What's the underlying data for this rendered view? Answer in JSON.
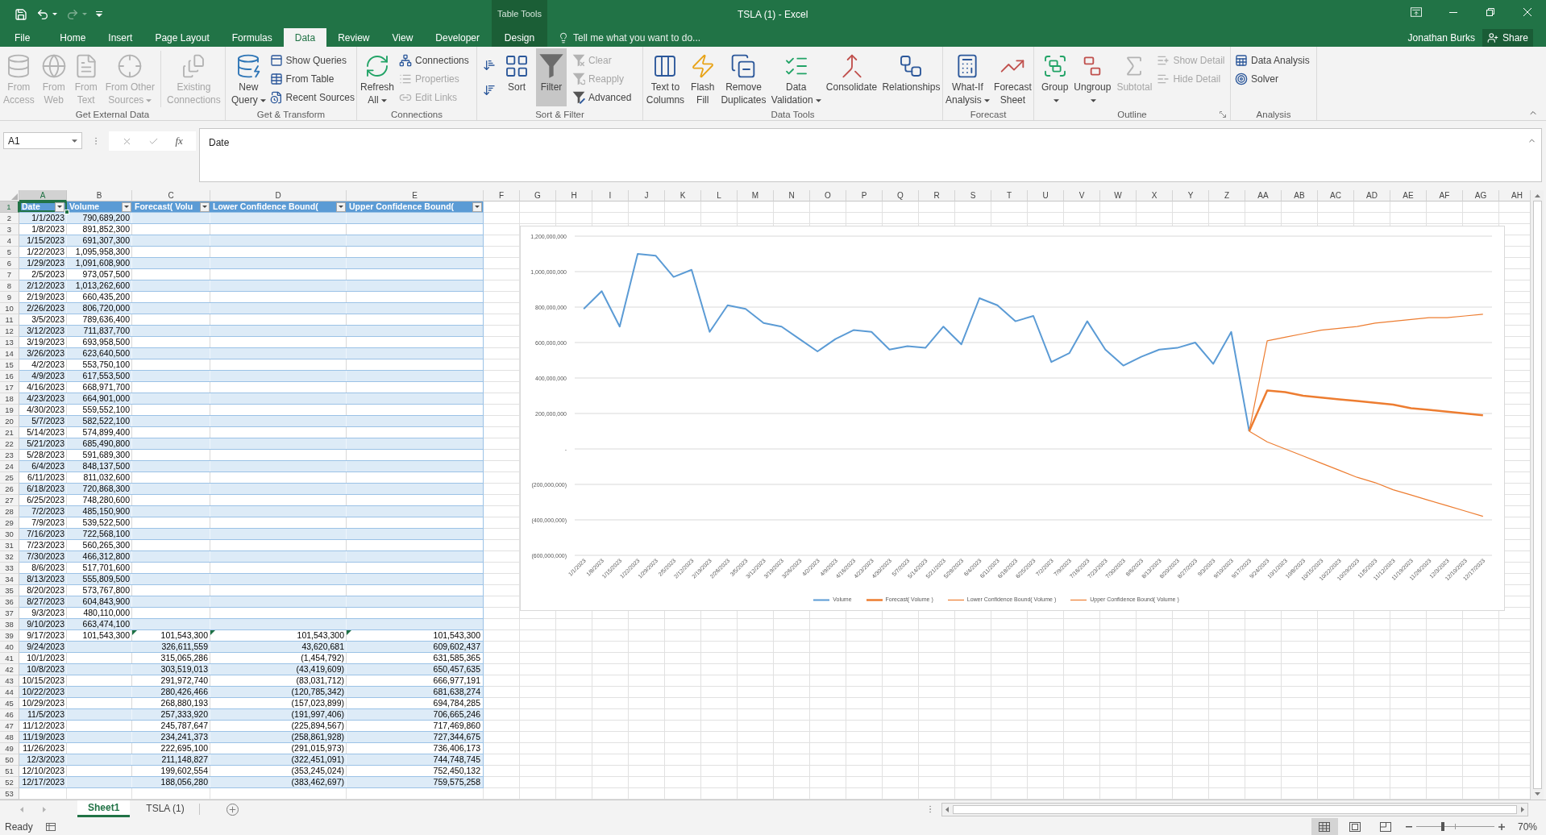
{
  "title_bar": {
    "title": "TSLA (1) - Excel",
    "context_label": "Table Tools"
  },
  "quick_access": [
    {
      "disabled": false,
      "dropdown": false
    },
    {
      "disabled": false,
      "dropdown": true
    },
    {
      "disabled": true,
      "dropdown": true
    }
  ],
  "ribbon_tabs": [
    {
      "label": "File",
      "selected": false,
      "contextual": false
    },
    {
      "label": "Home",
      "selected": false,
      "contextual": false
    },
    {
      "label": "Insert",
      "selected": false,
      "contextual": false
    },
    {
      "label": "Page Layout",
      "selected": false,
      "contextual": false
    },
    {
      "label": "Formulas",
      "selected": false,
      "contextual": false
    },
    {
      "label": "Data",
      "selected": true,
      "contextual": false
    },
    {
      "label": "Review",
      "selected": false,
      "contextual": false
    },
    {
      "label": "View",
      "selected": false,
      "contextual": false
    },
    {
      "label": "Developer",
      "selected": false,
      "contextual": false
    },
    {
      "label": "Design",
      "selected": false,
      "contextual": true
    }
  ],
  "tell_me": {
    "placeholder": "Tell me what you want to do..."
  },
  "account": {
    "user_name": "Jonathan Burks",
    "share_button": "Share"
  },
  "ribbon_groups": [
    {
      "label": "Get External Data",
      "launcher": false,
      "commands": [
        {
          "label": "From Access",
          "kind": "large",
          "disabled": true,
          "dropdown": false,
          "pressed": false
        },
        {
          "label": "From Web",
          "kind": "large",
          "disabled": true,
          "dropdown": false,
          "pressed": false
        },
        {
          "label": "From Text",
          "kind": "large",
          "disabled": true,
          "dropdown": false,
          "pressed": false
        },
        {
          "label": "From Other Sources",
          "kind": "large",
          "disabled": true,
          "dropdown": true,
          "pressed": false
        },
        {
          "kind": "separator"
        },
        {
          "label": "Existing Connections",
          "kind": "large",
          "disabled": true,
          "dropdown": false,
          "pressed": false
        }
      ]
    },
    {
      "label": "Get & Transform",
      "launcher": false,
      "commands": [
        {
          "label": "New Query",
          "kind": "large",
          "disabled": false,
          "dropdown": true,
          "pressed": false
        },
        {
          "label": "Show Queries",
          "kind": "small",
          "disabled": false,
          "dropdown": false,
          "pressed": false
        },
        {
          "label": "From Table",
          "kind": "small",
          "disabled": false,
          "dropdown": false,
          "pressed": false
        },
        {
          "label": "Recent Sources",
          "kind": "small",
          "disabled": false,
          "dropdown": false,
          "pressed": false
        }
      ]
    },
    {
      "label": "Connections",
      "launcher": false,
      "commands": [
        {
          "label": "Refresh All",
          "kind": "large",
          "disabled": false,
          "dropdown": true,
          "pressed": false
        },
        {
          "label": "Connections",
          "kind": "small",
          "disabled": false,
          "dropdown": false,
          "pressed": false
        },
        {
          "label": "Properties",
          "kind": "small",
          "disabled": true,
          "dropdown": false,
          "pressed": false
        },
        {
          "label": "Edit Links",
          "kind": "small",
          "disabled": true,
          "dropdown": false,
          "pressed": false
        }
      ]
    },
    {
      "label": "Sort & Filter",
      "launcher": false,
      "commands": [
        {
          "kind": "icon",
          "disabled": false,
          "dropdown": false,
          "pressed": false
        },
        {
          "kind": "icon",
          "disabled": false,
          "dropdown": false,
          "pressed": false
        },
        {
          "label": "Sort",
          "kind": "large",
          "disabled": false,
          "dropdown": false,
          "pressed": false
        },
        {
          "label": "Filter",
          "kind": "large",
          "disabled": false,
          "dropdown": false,
          "pressed": true
        },
        {
          "label": "Clear",
          "kind": "small",
          "disabled": true,
          "dropdown": false,
          "pressed": false
        },
        {
          "label": "Reapply",
          "kind": "small",
          "disabled": true,
          "dropdown": false,
          "pressed": false
        },
        {
          "label": "Advanced",
          "kind": "small",
          "disabled": false,
          "dropdown": false,
          "pressed": false
        }
      ]
    },
    {
      "label": "Data Tools",
      "launcher": false,
      "commands": [
        {
          "label": "Text to Columns",
          "kind": "large",
          "disabled": false,
          "dropdown": false,
          "pressed": false
        },
        {
          "label": "Flash Fill",
          "kind": "large",
          "disabled": false,
          "dropdown": false,
          "pressed": false
        },
        {
          "label": "Remove Duplicates",
          "kind": "large",
          "disabled": false,
          "dropdown": false,
          "pressed": false
        },
        {
          "label": "Data Validation",
          "kind": "large",
          "disabled": false,
          "dropdown": true,
          "pressed": false
        },
        {
          "label": "Consolidate",
          "kind": "large",
          "disabled": false,
          "dropdown": false,
          "pressed": false
        },
        {
          "label": "Relationships",
          "kind": "large",
          "disabled": false,
          "dropdown": false,
          "pressed": false
        }
      ]
    },
    {
      "label": "Forecast",
      "launcher": false,
      "commands": [
        {
          "label": "What-If Analysis",
          "kind": "large",
          "disabled": false,
          "dropdown": true,
          "pressed": false
        },
        {
          "label": "Forecast Sheet",
          "kind": "large",
          "disabled": false,
          "dropdown": false,
          "pressed": false
        }
      ]
    },
    {
      "label": "Outline",
      "launcher": true,
      "commands": [
        {
          "label": "Group",
          "kind": "large",
          "disabled": false,
          "dropdown": true,
          "pressed": false
        },
        {
          "label": "Ungroup",
          "kind": "large",
          "disabled": false,
          "dropdown": true,
          "pressed": false
        },
        {
          "label": "Subtotal",
          "kind": "large",
          "disabled": true,
          "dropdown": false,
          "pressed": false
        },
        {
          "label": "Show Detail",
          "kind": "small",
          "disabled": true,
          "dropdown": false,
          "pressed": false
        },
        {
          "label": "Hide Detail",
          "kind": "small",
          "disabled": true,
          "dropdown": false,
          "pressed": false
        }
      ]
    },
    {
      "label": "Analysis",
      "launcher": false,
      "commands": [
        {
          "label": "Data Analysis",
          "kind": "small",
          "disabled": false,
          "dropdown": false,
          "pressed": false
        },
        {
          "label": "Solver",
          "kind": "small",
          "disabled": false,
          "dropdown": false,
          "pressed": false
        }
      ]
    }
  ],
  "formula_bar": {
    "name_box": "A1",
    "function_button": "fx",
    "formula": "Date"
  },
  "sheet": {
    "column_headers": [
      {
        "label": "A",
        "selected": true
      },
      {
        "label": "B",
        "selected": false
      },
      {
        "label": "C",
        "selected": false
      },
      {
        "label": "D",
        "selected": false
      },
      {
        "label": "E",
        "selected": false
      },
      {
        "label": "F",
        "selected": false
      },
      {
        "label": "G",
        "selected": false
      },
      {
        "label": "H",
        "selected": false
      },
      {
        "label": "I",
        "selected": false
      },
      {
        "label": "J",
        "selected": false
      },
      {
        "label": "K",
        "selected": false
      },
      {
        "label": "L",
        "selected": false
      },
      {
        "label": "M",
        "selected": false
      },
      {
        "label": "N",
        "selected": false
      },
      {
        "label": "O",
        "selected": false
      },
      {
        "label": "P",
        "selected": false
      },
      {
        "label": "Q",
        "selected": false
      },
      {
        "label": "R",
        "selected": false
      },
      {
        "label": "S",
        "selected": false
      },
      {
        "label": "T",
        "selected": false
      },
      {
        "label": "U",
        "selected": false
      },
      {
        "label": "V",
        "selected": false
      },
      {
        "label": "W",
        "selected": false
      },
      {
        "label": "X",
        "selected": false
      },
      {
        "label": "Y",
        "selected": false
      },
      {
        "label": "Z",
        "selected": false
      },
      {
        "label": "AA",
        "selected": false
      },
      {
        "label": "AB",
        "selected": false
      },
      {
        "label": "AC",
        "selected": false
      },
      {
        "label": "AD",
        "selected": false
      },
      {
        "label": "AE",
        "selected": false
      },
      {
        "label": "AF",
        "selected": false
      },
      {
        "label": "AG",
        "selected": false
      },
      {
        "label": "AH",
        "selected": false
      }
    ],
    "row_headers": [
      {
        "label": "1",
        "selected": true
      },
      {
        "label": "2",
        "selected": false
      },
      {
        "label": "3",
        "selected": false
      },
      {
        "label": "4",
        "selected": false
      },
      {
        "label": "5",
        "selected": false
      },
      {
        "label": "6",
        "selected": false
      },
      {
        "label": "7",
        "selected": false
      },
      {
        "label": "8",
        "selected": false
      },
      {
        "label": "9",
        "selected": false
      },
      {
        "label": "10",
        "selected": false
      },
      {
        "label": "11",
        "selected": false
      },
      {
        "label": "12",
        "selected": false
      },
      {
        "label": "13",
        "selected": false
      },
      {
        "label": "14",
        "selected": false
      },
      {
        "label": "15",
        "selected": false
      },
      {
        "label": "16",
        "selected": false
      },
      {
        "label": "17",
        "selected": false
      },
      {
        "label": "18",
        "selected": false
      },
      {
        "label": "19",
        "selected": false
      },
      {
        "label": "20",
        "selected": false
      },
      {
        "label": "21",
        "selected": false
      },
      {
        "label": "22",
        "selected": false
      },
      {
        "label": "23",
        "selected": false
      },
      {
        "label": "24",
        "selected": false
      },
      {
        "label": "25",
        "selected": false
      },
      {
        "label": "26",
        "selected": false
      },
      {
        "label": "27",
        "selected": false
      },
      {
        "label": "28",
        "selected": false
      },
      {
        "label": "29",
        "selected": false
      },
      {
        "label": "30",
        "selected": false
      },
      {
        "label": "31",
        "selected": false
      },
      {
        "label": "32",
        "selected": false
      },
      {
        "label": "33",
        "selected": false
      },
      {
        "label": "34",
        "selected": false
      },
      {
        "label": "35",
        "selected": false
      },
      {
        "label": "36",
        "selected": false
      },
      {
        "label": "37",
        "selected": false
      },
      {
        "label": "38",
        "selected": false
      },
      {
        "label": "39",
        "selected": false
      },
      {
        "label": "40",
        "selected": false
      },
      {
        "label": "41",
        "selected": false
      },
      {
        "label": "42",
        "selected": false
      },
      {
        "label": "43",
        "selected": false
      },
      {
        "label": "44",
        "selected": false
      },
      {
        "label": "45",
        "selected": false
      },
      {
        "label": "46",
        "selected": false
      },
      {
        "label": "47",
        "selected": false
      },
      {
        "label": "48",
        "selected": false
      },
      {
        "label": "49",
        "selected": false
      },
      {
        "label": "50",
        "selected": false
      },
      {
        "label": "51",
        "selected": false
      },
      {
        "label": "52",
        "selected": false
      },
      {
        "label": "53",
        "selected": false
      }
    ],
    "table": {
      "columns": [
        {
          "label": "Date"
        },
        {
          "label": "Volume"
        },
        {
          "label": "Forecast( Volu"
        },
        {
          "label": "Lower Confidence Bound("
        },
        {
          "label": "Upper Confidence Bound("
        }
      ],
      "rows": [
        {
          "date": "1/1/2023",
          "volume": "790,689,200",
          "flagged": false
        },
        {
          "date": "1/8/2023",
          "volume": "891,852,300",
          "flagged": false
        },
        {
          "date": "1/15/2023",
          "volume": "691,307,300",
          "flagged": false
        },
        {
          "date": "1/22/2023",
          "volume": "1,095,958,300",
          "flagged": false
        },
        {
          "date": "1/29/2023",
          "volume": "1,091,608,900",
          "flagged": false
        },
        {
          "date": "2/5/2023",
          "volume": "973,057,500",
          "flagged": false
        },
        {
          "date": "2/12/2023",
          "volume": "1,013,262,600",
          "flagged": false
        },
        {
          "date": "2/19/2023",
          "volume": "660,435,200",
          "flagged": false
        },
        {
          "date": "2/26/2023",
          "volume": "806,720,000",
          "flagged": false
        },
        {
          "date": "3/5/2023",
          "volume": "789,636,400",
          "flagged": false
        },
        {
          "date": "3/12/2023",
          "volume": "711,837,700",
          "flagged": false
        },
        {
          "date": "3/19/2023",
          "volume": "693,958,500",
          "flagged": false
        },
        {
          "date": "3/26/2023",
          "volume": "623,640,500",
          "flagged": false
        },
        {
          "date": "4/2/2023",
          "volume": "553,750,100",
          "flagged": false
        },
        {
          "date": "4/9/2023",
          "volume": "617,553,500",
          "flagged": false
        },
        {
          "date": "4/16/2023",
          "volume": "668,971,700",
          "flagged": false
        },
        {
          "date": "4/23/2023",
          "volume": "664,901,000",
          "flagged": false
        },
        {
          "date": "4/30/2023",
          "volume": "559,552,100",
          "flagged": false
        },
        {
          "date": "5/7/2023",
          "volume": "582,522,100",
          "flagged": false
        },
        {
          "date": "5/14/2023",
          "volume": "574,899,400",
          "flagged": false
        },
        {
          "date": "5/21/2023",
          "volume": "685,490,800",
          "flagged": false
        },
        {
          "date": "5/28/2023",
          "volume": "591,689,300",
          "flagged": false
        },
        {
          "date": "6/4/2023",
          "volume": "848,137,500",
          "flagged": false
        },
        {
          "date": "6/11/2023",
          "volume": "811,032,600",
          "flagged": false
        },
        {
          "date": "6/18/2023",
          "volume": "720,868,300",
          "flagged": false
        },
        {
          "date": "6/25/2023",
          "volume": "748,280,600",
          "flagged": false
        },
        {
          "date": "7/2/2023",
          "volume": "485,150,900",
          "flagged": false
        },
        {
          "date": "7/9/2023",
          "volume": "539,522,500",
          "flagged": false
        },
        {
          "date": "7/16/2023",
          "volume": "722,568,100",
          "flagged": false
        },
        {
          "date": "7/23/2023",
          "volume": "560,265,300",
          "flagged": false
        },
        {
          "date": "7/30/2023",
          "volume": "466,312,800",
          "flagged": false
        },
        {
          "date": "8/6/2023",
          "volume": "517,701,600",
          "flagged": false
        },
        {
          "date": "8/13/2023",
          "volume": "555,809,500",
          "flagged": false
        },
        {
          "date": "8/20/2023",
          "volume": "573,767,800",
          "flagged": false
        },
        {
          "date": "8/27/2023",
          "volume": "604,843,900",
          "flagged": false
        },
        {
          "date": "9/3/2023",
          "volume": "480,110,000",
          "flagged": false
        },
        {
          "date": "9/10/2023",
          "volume": "663,474,100",
          "flagged": false
        },
        {
          "date": "9/17/2023",
          "volume": "101,543,300",
          "forecast": "101,543,300",
          "lower_bound": "101,543,300",
          "upper_bound": "101,543,300",
          "flagged": true
        },
        {
          "date": "9/24/2023",
          "forecast": "326,611,559",
          "lower_bound": "43,620,681",
          "upper_bound": "609,602,437",
          "flagged": false
        },
        {
          "date": "10/1/2023",
          "forecast": "315,065,286",
          "lower_bound": "(1,454,792)",
          "upper_bound": "631,585,365",
          "flagged": false
        },
        {
          "date": "10/8/2023",
          "forecast": "303,519,013",
          "lower_bound": "(43,419,609)",
          "upper_bound": "650,457,635",
          "flagged": false
        },
        {
          "date": "10/15/2023",
          "forecast": "291,972,740",
          "lower_bound": "(83,031,712)",
          "upper_bound": "666,977,191",
          "flagged": false
        },
        {
          "date": "10/22/2023",
          "forecast": "280,426,466",
          "lower_bound": "(120,785,342)",
          "upper_bound": "681,638,274",
          "flagged": false
        },
        {
          "date": "10/29/2023",
          "forecast": "268,880,193",
          "lower_bound": "(157,023,899)",
          "upper_bound": "694,784,285",
          "flagged": false
        },
        {
          "date": "11/5/2023",
          "forecast": "257,333,920",
          "lower_bound": "(191,997,406)",
          "upper_bound": "706,665,246",
          "flagged": false
        },
        {
          "date": "11/12/2023",
          "forecast": "245,787,647",
          "lower_bound": "(225,894,567)",
          "upper_bound": "717,469,860",
          "flagged": false
        },
        {
          "date": "11/19/2023",
          "forecast": "234,241,373",
          "lower_bound": "(258,861,928)",
          "upper_bound": "727,344,675",
          "flagged": false
        },
        {
          "date": "11/26/2023",
          "forecast": "222,695,100",
          "lower_bound": "(291,015,973)",
          "upper_bound": "736,406,173",
          "flagged": false
        },
        {
          "date": "12/3/2023",
          "forecast": "211,148,827",
          "lower_bound": "(322,451,091)",
          "upper_bound": "744,748,745",
          "flagged": false
        },
        {
          "date": "12/10/2023",
          "forecast": "199,602,554",
          "lower_bound": "(353,245,024)",
          "upper_bound": "752,450,132",
          "flagged": false
        },
        {
          "date": "12/17/2023",
          "forecast": "188,056,280",
          "lower_bound": "(383,462,697)",
          "upper_bound": "759,575,258",
          "flagged": false
        }
      ]
    }
  },
  "chart": {
    "chart_data": {
      "type": "line",
      "categories": [
        "1/1/2023",
        "1/8/2023",
        "1/15/2023",
        "1/22/2023",
        "1/29/2023",
        "2/5/2023",
        "2/12/2023",
        "2/19/2023",
        "2/26/2023",
        "3/5/2023",
        "3/12/2023",
        "3/19/2023",
        "3/26/2023",
        "4/2/2023",
        "4/9/2023",
        "4/16/2023",
        "4/23/2023",
        "4/30/2023",
        "5/7/2023",
        "5/14/2023",
        "5/21/2023",
        "5/28/2023",
        "6/4/2023",
        "6/11/2023",
        "6/18/2023",
        "6/25/2023",
        "7/2/2023",
        "7/9/2023",
        "7/16/2023",
        "7/23/2023",
        "7/30/2023",
        "8/6/2023",
        "8/13/2023",
        "8/20/2023",
        "8/27/2023",
        "9/3/2023",
        "9/10/2023",
        "9/17/2023",
        "9/24/2023",
        "10/1/2023",
        "10/8/2023",
        "10/15/2023",
        "10/22/2023",
        "10/29/2023",
        "11/5/2023",
        "11/12/2023",
        "11/19/2023",
        "11/26/2023",
        "12/3/2023",
        "12/10/2023",
        "12/17/2023"
      ],
      "series": [
        {
          "name": "Volume",
          "color": "#5b9bd5",
          "values": [
            790000000,
            890000000,
            690000000,
            1100000000,
            1090000000,
            970000000,
            1010000000,
            660000000,
            810000000,
            790000000,
            710000000,
            690000000,
            620000000,
            550000000,
            620000000,
            670000000,
            660000000,
            560000000,
            580000000,
            570000000,
            690000000,
            590000000,
            850000000,
            810000000,
            720000000,
            750000000,
            490000000,
            540000000,
            720000000,
            560000000,
            470000000,
            520000000,
            560000000,
            570000000,
            600000000,
            480000000,
            660000000,
            100000000,
            null,
            null,
            null,
            null,
            null,
            null,
            null,
            null,
            null,
            null,
            null,
            null,
            null
          ]
        },
        {
          "name": "Forecast( Volume )",
          "color": "#ed7d31",
          "values": [
            null,
            null,
            null,
            null,
            null,
            null,
            null,
            null,
            null,
            null,
            null,
            null,
            null,
            null,
            null,
            null,
            null,
            null,
            null,
            null,
            null,
            null,
            null,
            null,
            null,
            null,
            null,
            null,
            null,
            null,
            null,
            null,
            null,
            null,
            null,
            null,
            null,
            100000000,
            330000000,
            320000000,
            300000000,
            290000000,
            280000000,
            270000000,
            260000000,
            250000000,
            230000000,
            220000000,
            210000000,
            200000000,
            190000000
          ]
        },
        {
          "name": "Lower Confidence Bound( Volume )",
          "color": "#ed7d31",
          "values": [
            null,
            null,
            null,
            null,
            null,
            null,
            null,
            null,
            null,
            null,
            null,
            null,
            null,
            null,
            null,
            null,
            null,
            null,
            null,
            null,
            null,
            null,
            null,
            null,
            null,
            null,
            null,
            null,
            null,
            null,
            null,
            null,
            null,
            null,
            null,
            null,
            null,
            100000000,
            40000000,
            0,
            -40000000,
            -80000000,
            -120000000,
            -160000000,
            -190000000,
            -230000000,
            -260000000,
            -290000000,
            -320000000,
            -350000000,
            -380000000
          ]
        },
        {
          "name": "Upper Confidence Bound( Volume )",
          "color": "#ed7d31",
          "values": [
            null,
            null,
            null,
            null,
            null,
            null,
            null,
            null,
            null,
            null,
            null,
            null,
            null,
            null,
            null,
            null,
            null,
            null,
            null,
            null,
            null,
            null,
            null,
            null,
            null,
            null,
            null,
            null,
            null,
            null,
            null,
            null,
            null,
            null,
            null,
            null,
            null,
            100000000,
            610000000,
            630000000,
            650000000,
            670000000,
            680000000,
            690000000,
            710000000,
            720000000,
            730000000,
            740000000,
            740000000,
            750000000,
            760000000
          ]
        }
      ],
      "ylim": [
        -600000000,
        1200000000
      ],
      "yticks": [
        {
          "value": 1200000000,
          "label": "1,200,000,000"
        },
        {
          "value": 1000000000,
          "label": "1,000,000,000"
        },
        {
          "value": 800000000,
          "label": "800,000,000"
        },
        {
          "value": 600000000,
          "label": "600,000,000"
        },
        {
          "value": 400000000,
          "label": "400,000,000"
        },
        {
          "value": 200000000,
          "label": "200,000,000"
        },
        {
          "value": 0,
          "label": "-"
        },
        {
          "value": -200000000,
          "label": "(200,000,000)"
        },
        {
          "value": -400000000,
          "label": "(400,000,000)"
        },
        {
          "value": -600000000,
          "label": "(600,000,000)"
        }
      ],
      "grid": true,
      "legend": "bottom"
    }
  },
  "sheet_tabs": [
    {
      "label": "Sheet1",
      "selected": true
    },
    {
      "label": "TSLA (1)",
      "selected": false
    }
  ],
  "status_bar": {
    "status": "Ready",
    "views": [
      {
        "selected": true
      },
      {
        "selected": false
      },
      {
        "selected": false
      }
    ],
    "zoom": {
      "level": 0.34,
      "label": "70%"
    }
  }
}
